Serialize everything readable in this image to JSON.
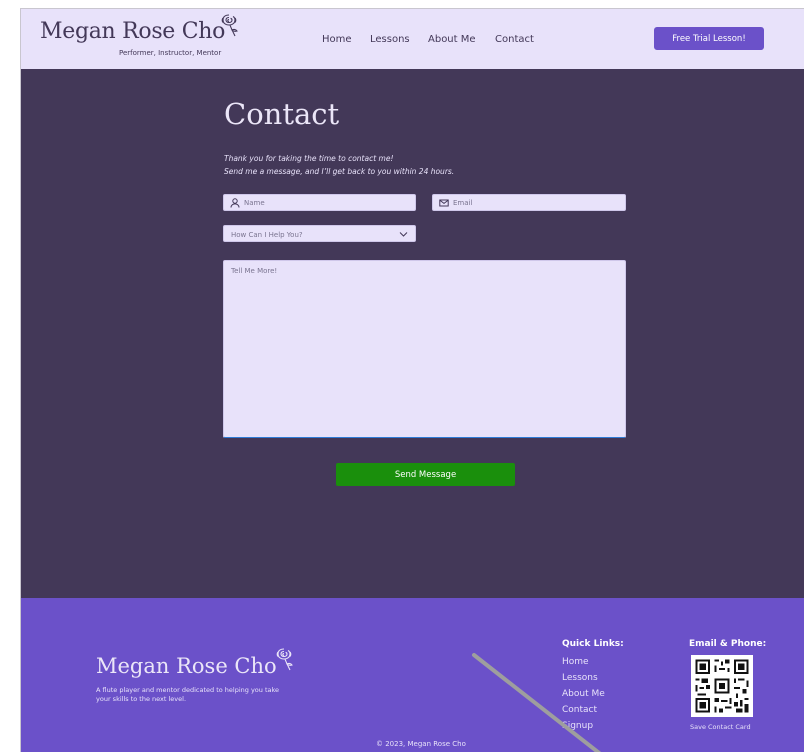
{
  "header": {
    "brand_name": "Megan Rose Cho",
    "brand_tagline": "Performer, Instructor, Mentor",
    "nav": [
      "Home",
      "Lessons",
      "About Me",
      "Contact"
    ],
    "cta_label": "Free Trial Lesson!"
  },
  "contact": {
    "title": "Contact",
    "intro_line1": "Thank you for taking the time to contact me!",
    "intro_line2": "Send me a message, and I’ll get back to you within 24 hours.",
    "name_placeholder": "Name",
    "email_placeholder": "Email",
    "help_select_value": "How Can I Help You?",
    "message_placeholder": "Tell Me More!",
    "send_label": "Send Message"
  },
  "footer": {
    "brand_name": "Megan Rose Cho",
    "description": "A flute player and mentor dedicated to helping you take your skills to the next level.",
    "quick_links_heading": "Quick Links:",
    "quick_links": [
      "Home",
      "Lessons",
      "About Me",
      "Contact",
      "Signup"
    ],
    "email_phone_heading": "Email & Phone:",
    "save_card_label": "Save Contact Card",
    "copyright": "© 2023, Megan Rose Cho"
  },
  "colors": {
    "header_bg": "#e8e2fa",
    "body_bg": "#433858",
    "accent": "#6b51c9",
    "send_button": "#1a8f0c"
  },
  "icons": [
    "rose-logo-icon",
    "user-icon",
    "mail-icon",
    "chevron-down-icon",
    "qr-code-icon"
  ]
}
